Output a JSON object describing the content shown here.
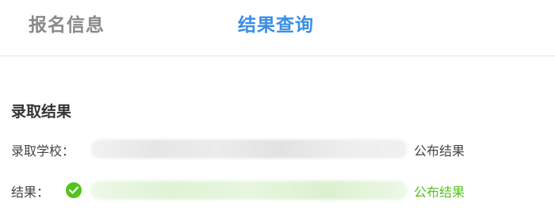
{
  "tabs": [
    {
      "label": "报名信息",
      "active": false
    },
    {
      "label": "结果查询",
      "active": true
    }
  ],
  "section": {
    "title": "录取结果"
  },
  "admission": {
    "school_label": "录取学校：",
    "school_trailing": "公布结果",
    "result_label": "结果：",
    "result_trailing": "公布结果"
  },
  "icons": {
    "result_status": "check-circle-icon"
  },
  "colors": {
    "active_tab": "#3a8ee6",
    "inactive_tab": "#8a8a8a",
    "success": "#52c41a"
  }
}
